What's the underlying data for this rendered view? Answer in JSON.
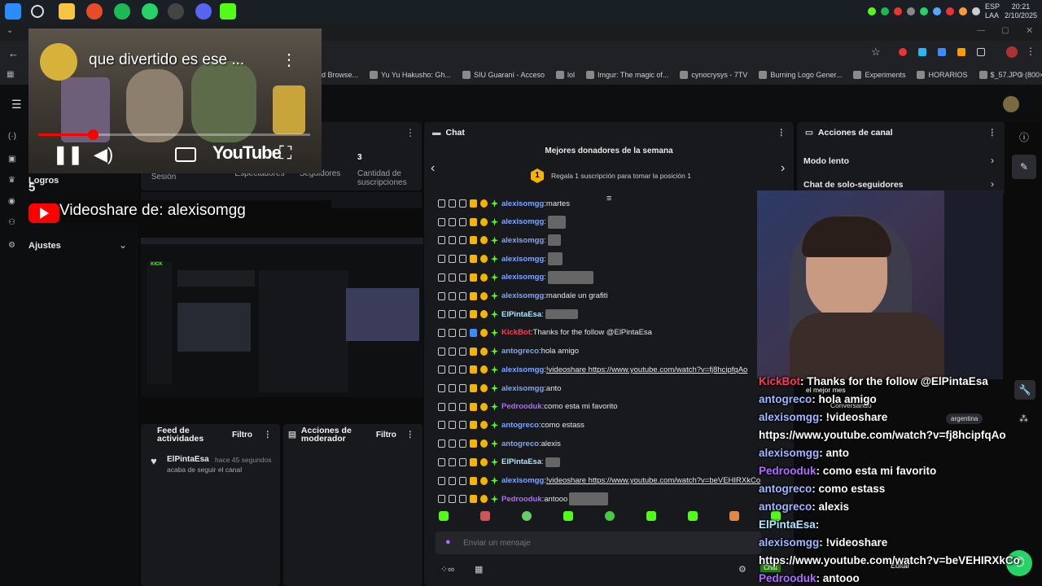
{
  "taskbar": {
    "lang_top": "ESP",
    "lang_bottom": "LAA",
    "time": "20:21",
    "date": "2/10/2025"
  },
  "bookmarks": [
    "d Browse...",
    "Yu Yu Hakusho: Gh...",
    "SIU Guaraní - Acceso",
    "lol",
    "Imgur: The magic of...",
    "cynocrysys - 7TV",
    "Burning Logo Gener...",
    "Experiments",
    "HORARIOS",
    "$_57.JPG (800×1200)"
  ],
  "youtube_overlay": {
    "title": "que divertido es ese ...",
    "brand": "YouTube",
    "progress": 0.2
  },
  "videoshare_label": "Videoshare de: alexisomgg",
  "sidebar": {
    "logros": "Logros",
    "number": "5",
    "ajustes": "Ajustes"
  },
  "stats": {
    "sesion": "Sesión",
    "espectadores": "Espectadores",
    "seguidores": "Seguidores",
    "suscripciones_value": "3",
    "suscripciones_label": "Cantidad de suscripciones"
  },
  "feed": {
    "title": "Feed de actividades",
    "filter": "Filtro",
    "user": "ElPintaEsa",
    "time": "hace 45 segundos",
    "action": "acaba de seguir el canal"
  },
  "moderator": {
    "title": "Acciones de moderador",
    "filter": "Filtro"
  },
  "chat": {
    "title": "Chat",
    "donors_title": "Mejores donadores de la semana",
    "donors_rank": "1",
    "donors_sub": "Regala 1 suscripción para tomar la posición 1",
    "input_placeholder": "Enviar un mensaje",
    "messages": [
      {
        "user": "alexisomgg",
        "text": "martes",
        "cls": "u1"
      },
      {
        "user": "alexisomgg",
        "text": "",
        "cls": "u1"
      },
      {
        "user": "alexisomgg",
        "text": "",
        "cls": "u1"
      },
      {
        "user": "alexisomgg",
        "text": "",
        "cls": "u1"
      },
      {
        "user": "alexisomgg",
        "text": "",
        "cls": "u1"
      },
      {
        "user": "alexisomgg",
        "text": "mandale un grafiti",
        "cls": "u1"
      },
      {
        "user": "ElPintaEsa",
        "text": "",
        "cls": "u5"
      },
      {
        "user": "KickBot",
        "text": "Thanks for the follow @ElPintaEsa",
        "cls": "u4"
      },
      {
        "user": "antogreco",
        "text": "hola amigo",
        "cls": "u1"
      },
      {
        "user": "alexisomgg",
        "text": "!videoshare https://www.youtube.com/watch?v=fj8hcipfqAo",
        "cls": "u1"
      },
      {
        "user": "alexisomgg",
        "text": "anto",
        "cls": "u1"
      },
      {
        "user": "Pedrooduk",
        "text": "como esta mi favorito",
        "cls": "u3"
      },
      {
        "user": "antogreco",
        "text": "como estass",
        "cls": "u1"
      },
      {
        "user": "antogreco",
        "text": "alexis",
        "cls": "u1"
      },
      {
        "user": "ElPintaEsa",
        "text": "",
        "cls": "u5"
      },
      {
        "user": "alexisomgg",
        "text": "!videoshare https://www.youtube.com/watch?v=beVEHIRXkCo",
        "cls": "u1"
      },
      {
        "user": "Pedrooduk",
        "text": "antooo",
        "cls": "u3"
      }
    ]
  },
  "channel_actions": {
    "title": "Acciones de canal",
    "modo_lento": "Modo lento",
    "solo_seguidores": "Chat de solo-seguidores"
  },
  "overlay_chat": [
    {
      "user": "KickBot",
      "text": "Thanks for the follow @ElPintaEsa"
    },
    {
      "user": "antogreco",
      "text": "hola amigo"
    },
    {
      "user": "alexisomgg",
      "text": "!videoshare"
    },
    {
      "user": "",
      "text": "https://www.youtube.com/watch?v=fj8hcipfqAo"
    },
    {
      "user": "alexisomgg",
      "text": "anto"
    },
    {
      "user": "Pedrooduk",
      "text": "como esta mi  favorito"
    },
    {
      "user": "antogreco",
      "text": "como estass"
    },
    {
      "user": "antogreco",
      "text": "alexis"
    },
    {
      "user": "ElPintaEsa",
      "text": ""
    },
    {
      "user": "alexisomgg",
      "text": "!videoshare"
    },
    {
      "user": "",
      "text": "https://www.youtube.com/watch?v=beVEHIRXkCo"
    },
    {
      "user": "Pedrooduk",
      "text": "antooo"
    }
  ],
  "misc": {
    "mejor_mes": "el mejor mes",
    "conversando": "Conversando",
    "tag": "argentina",
    "editar": "Editar",
    "chat_chip": "Chat"
  },
  "colors": {
    "kick_green": "#53fc18",
    "panel": "#18191c",
    "youtube_red": "#ff0000"
  }
}
